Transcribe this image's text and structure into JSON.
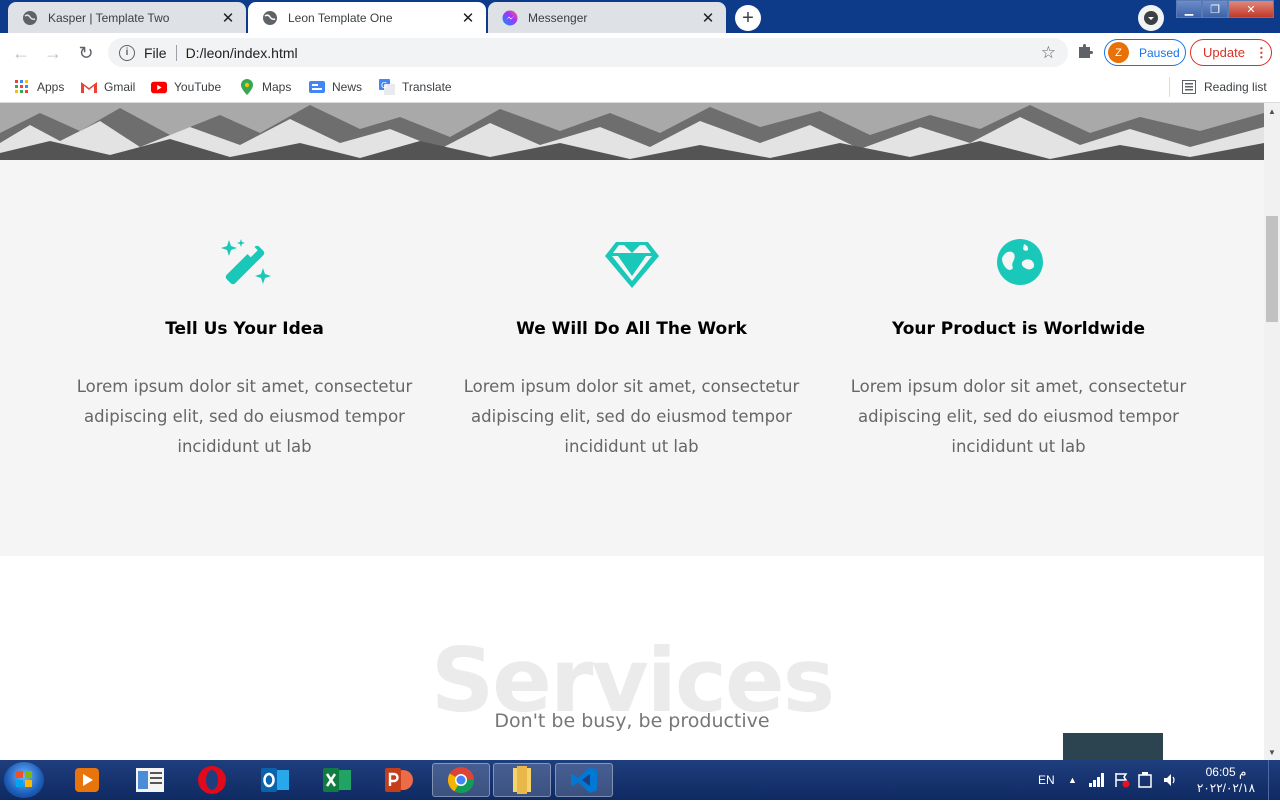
{
  "browser": {
    "tabs": [
      {
        "label": "Kasper | Template Two",
        "icon": "globe-icon",
        "active": false
      },
      {
        "label": "Leon Template One",
        "icon": "globe-icon",
        "active": true
      },
      {
        "label": "Messenger",
        "icon": "messenger-icon",
        "active": false
      }
    ],
    "new_tab": "+",
    "omnibox": {
      "scheme_label": "File",
      "url": "D:/leon/index.html"
    },
    "profile": {
      "initial": "Z",
      "status": "Paused"
    },
    "update_label": "Update",
    "bookmarks": [
      {
        "label": "Apps",
        "icon": "apps-grid-icon"
      },
      {
        "label": "Gmail",
        "icon": "gmail-icon"
      },
      {
        "label": "YouTube",
        "icon": "youtube-icon"
      },
      {
        "label": "Maps",
        "icon": "maps-pin-icon"
      },
      {
        "label": "News",
        "icon": "news-icon"
      },
      {
        "label": "Translate",
        "icon": "translate-icon"
      }
    ],
    "reading_list": "Reading list"
  },
  "page": {
    "features": [
      {
        "icon": "magic-wand-icon",
        "title": "Tell Us Your Idea",
        "text": "Lorem ipsum dolor sit amet, consectetur adipiscing elit, sed do eiusmod tempor incididunt ut lab"
      },
      {
        "icon": "diamond-icon",
        "title": "We Will Do All The Work",
        "text": "Lorem ipsum dolor sit amet, consectetur adipiscing elit, sed do eiusmod tempor incididunt ut lab"
      },
      {
        "icon": "globe-earth-icon",
        "title": "Your Product is Worldwide",
        "text": "Lorem ipsum dolor sit amet, consectetur adipiscing elit, sed do eiusmod tempor incididunt ut lab"
      }
    ],
    "services": {
      "title": "Services",
      "subtitle": "Don't be busy, be productive"
    },
    "accent_color": "#19c8b9"
  },
  "taskbar": {
    "apps": [
      "media-player-icon",
      "file-manager-icon",
      "opera-icon",
      "outlook-icon",
      "excel-icon",
      "powerpoint-icon",
      "chrome-icon",
      "folder-icon",
      "vscode-icon"
    ],
    "language": "EN",
    "time": "06:05 م",
    "date": "٢٠٢٢/٠٢/١٨"
  }
}
